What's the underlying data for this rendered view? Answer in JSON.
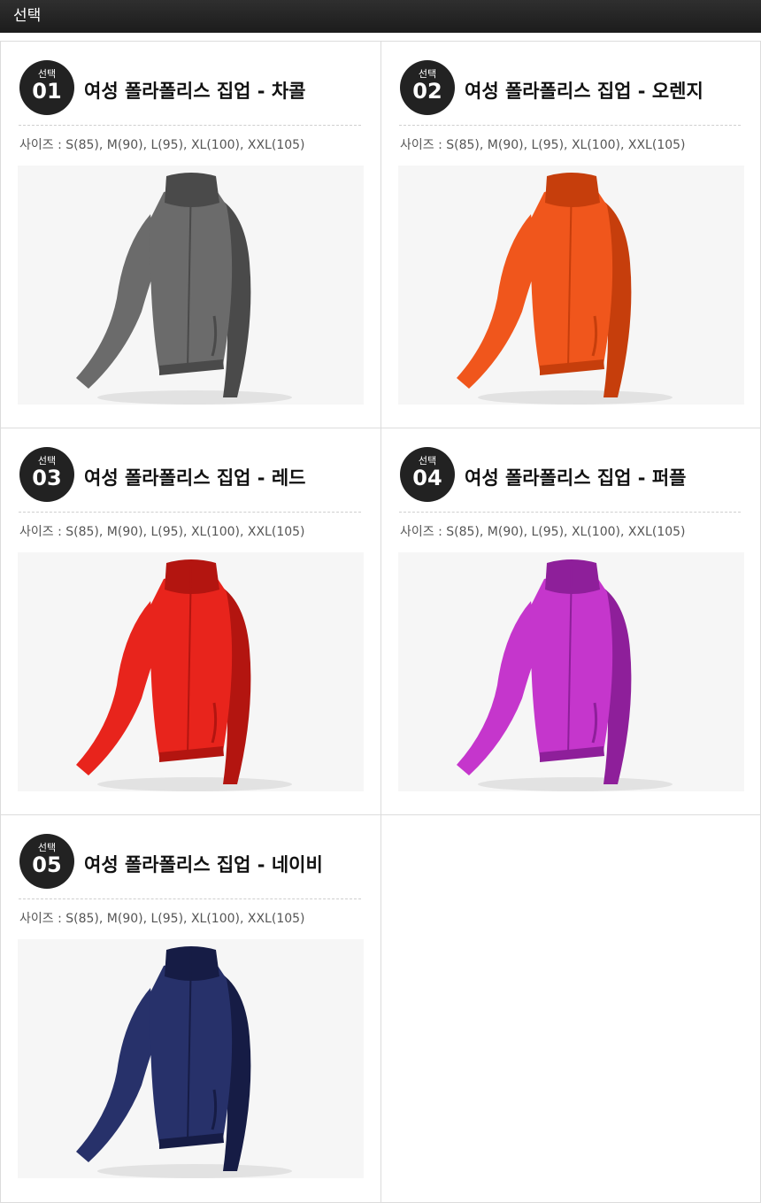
{
  "header": {
    "title": "선택"
  },
  "products": [
    {
      "badge_label": "선택",
      "number": "01",
      "title": "여성 폴라폴리스 집업 - 차콜",
      "sizes": "사이즈 : S(85), M(90), L(95), XL(100), XXL(105)",
      "color": "#6b6b6b",
      "color_dark": "#4a4a4a"
    },
    {
      "badge_label": "선택",
      "number": "02",
      "title": "여성 폴라폴리스 집업 - 오렌지",
      "sizes": "사이즈 : S(85), M(90), L(95), XL(100), XXL(105)",
      "color": "#f0561c",
      "color_dark": "#c63e0c"
    },
    {
      "badge_label": "선택",
      "number": "03",
      "title": "여성 폴라폴리스 집업 - 레드",
      "sizes": "사이즈 : S(85), M(90), L(95), XL(100), XXL(105)",
      "color": "#e8241c",
      "color_dark": "#b31510"
    },
    {
      "badge_label": "선택",
      "number": "04",
      "title": "여성 폴라폴리스 집업 - 퍼플",
      "sizes": "사이즈 : S(85), M(90), L(95), XL(100), XXL(105)",
      "color": "#c536cc",
      "color_dark": "#8e1f9a"
    },
    {
      "badge_label": "선택",
      "number": "05",
      "title": "여성 폴라폴리스 집업 - 네이비",
      "sizes": "사이즈 : S(85), M(90), L(95), XL(100), XXL(105)",
      "color": "#27316a",
      "color_dark": "#161c45"
    }
  ]
}
